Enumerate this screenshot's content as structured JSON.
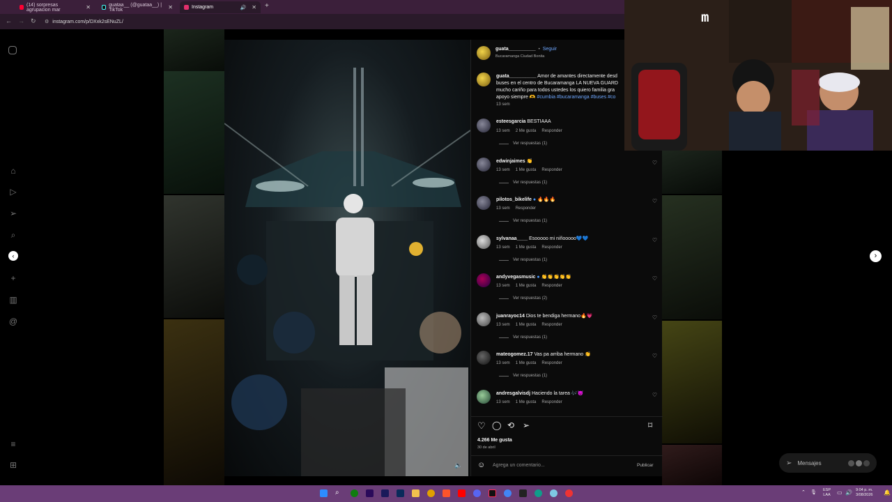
{
  "browser": {
    "tabs": [
      {
        "label": "(14) sorpresas agrupacion mar",
        "color": "#ff0033"
      },
      {
        "label": "guataa__ (@guataa__) | TikTok",
        "color": "#111111"
      },
      {
        "label": "Instagram",
        "color": "#e1306c"
      }
    ],
    "url": "instagram.com/p/DXxk2sENuZL/"
  },
  "post": {
    "author": "guata__________",
    "follow_label": "Seguir",
    "location": "Bucaramanga Ciudad Bonita",
    "caption_user": "guata__________",
    "caption_line1": "Amor de amantes directamente desd",
    "caption_line2": "buses en el centro de Bucaramanga LA NUEVA GUARD",
    "caption_line3": "mucho cariño para todos ustedes los quiero familia gra",
    "caption_line4_text": "apoyo siempre 🫶",
    "caption_tags": "#cumbia #bucaramanga #buses #co",
    "caption_time": "13 sem",
    "likes": "4.266 Me gusta",
    "date": "30 de abril",
    "comment_placeholder": "Agrega un comentario...",
    "publish_label": "Publicar"
  },
  "comments": [
    {
      "user": "esteesgarcia",
      "text": "BESTIAAA",
      "time": "13 sem",
      "likes": "2 Me gusta",
      "reply": "Responder",
      "replies": "Ver respuestas (1)"
    },
    {
      "user": "edwinjaimes",
      "text": "👏",
      "time": "13 sem",
      "likes": "1 Me gusta",
      "reply": "Responder",
      "replies": "Ver respuestas (1)"
    },
    {
      "user": "pilotos_bikelife",
      "text": "🔥🔥🔥",
      "time": "13 sem",
      "likes": "",
      "reply": "Responder",
      "replies": "Ver respuestas (1)"
    },
    {
      "user": "sylvanaa____",
      "text": "Esooooo mi niñooooo💙💙",
      "time": "13 sem",
      "likes": "1 Me gusta",
      "reply": "Responder",
      "replies": "Ver respuestas (1)"
    },
    {
      "user": "andyvegasmusic",
      "text": "👏👏👏👏👏",
      "time": "13 sem",
      "likes": "1 Me gusta",
      "reply": "Responder",
      "replies": "Ver respuestas (2)"
    },
    {
      "user": "juanrayoc14",
      "text": "Dios te bendiga hermano🔥💗",
      "time": "13 sem",
      "likes": "1 Me gusta",
      "reply": "Responder",
      "replies": "Ver respuestas (1)"
    },
    {
      "user": "mateogomez.17",
      "text": "Vas pa arriba hermano 👏",
      "time": "13 sem",
      "likes": "1 Me gusta",
      "reply": "Responder",
      "replies": "Ver respuestas (1)"
    },
    {
      "user": "andresgalvisdj",
      "text": "Haciendo la tarea 🎶😈",
      "time": "13 sem",
      "likes": "1 Me gusta",
      "reply": "Responder",
      "replies": ""
    }
  ],
  "messages_label": "Mensajes",
  "taskbar": {
    "lang": "ESP",
    "lang2": "LAA",
    "time": "9:04 p. m.",
    "date": "3/08/2026"
  },
  "webcam": {
    "logo": "m"
  }
}
